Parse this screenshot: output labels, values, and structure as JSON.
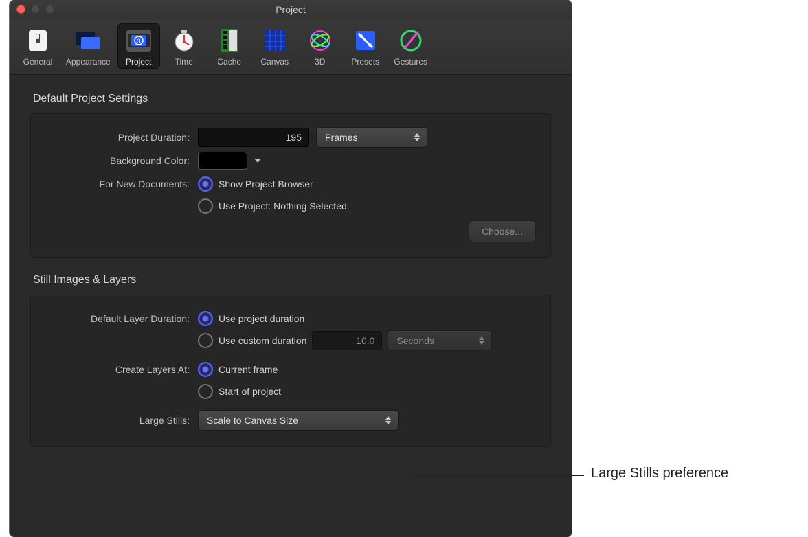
{
  "window": {
    "title": "Project"
  },
  "toolbar": {
    "items": [
      {
        "label": "General"
      },
      {
        "label": "Appearance"
      },
      {
        "label": "Project"
      },
      {
        "label": "Time"
      },
      {
        "label": "Cache"
      },
      {
        "label": "Canvas"
      },
      {
        "label": "3D"
      },
      {
        "label": "Presets"
      },
      {
        "label": "Gestures"
      }
    ]
  },
  "sections": {
    "defaultProject": {
      "title": "Default Project Settings",
      "projectDurationLabel": "Project Duration:",
      "projectDurationValue": "195",
      "projectDurationUnit": "Frames",
      "backgroundColorLabel": "Background Color:",
      "forNewDocsLabel": "For New Documents:",
      "option1": "Show Project Browser",
      "option2": "Use Project: Nothing Selected.",
      "chooseButton": "Choose..."
    },
    "stillImages": {
      "title": "Still Images & Layers",
      "defaultLayerDurationLabel": "Default Layer Duration:",
      "dldOpt1": "Use project duration",
      "dldOpt2": "Use custom duration",
      "customDurationValue": "10.0",
      "customDurationUnit": "Seconds",
      "createLayersAtLabel": "Create Layers At:",
      "claOpt1": "Current frame",
      "claOpt2": "Start of project",
      "largeStillsLabel": "Large Stills:",
      "largeStillsValue": "Scale to Canvas Size"
    }
  },
  "annotation": {
    "largeStills": "Large Stills preference"
  }
}
